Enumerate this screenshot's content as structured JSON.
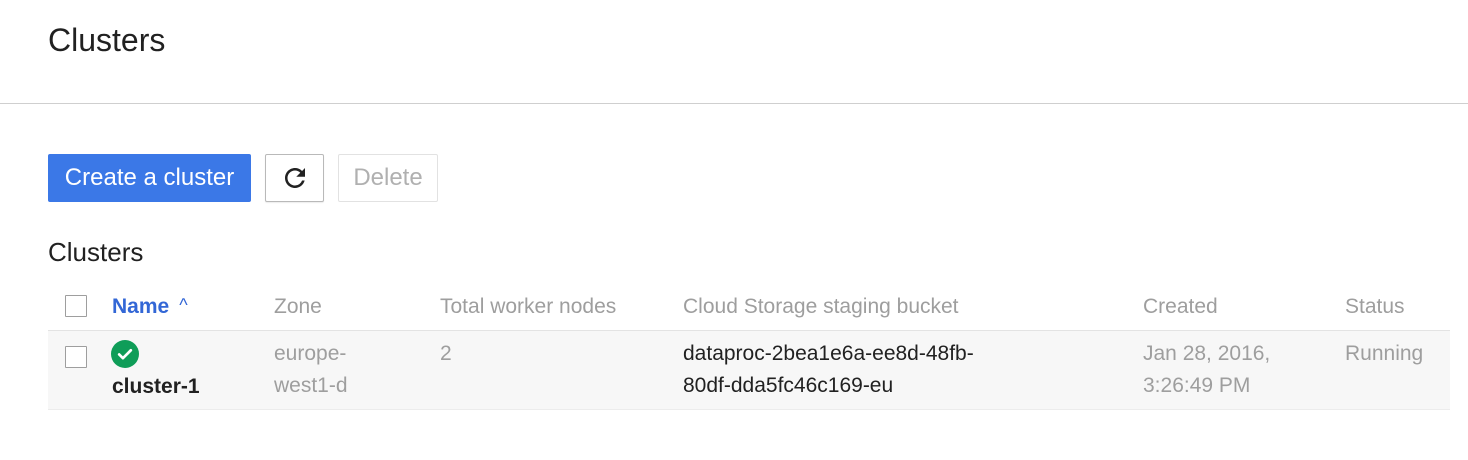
{
  "header": {
    "title": "Clusters"
  },
  "toolbar": {
    "create_label": "Create a cluster",
    "refresh_icon": "refresh-icon",
    "delete_label": "Delete"
  },
  "section": {
    "title": "Clusters"
  },
  "table": {
    "columns": {
      "name": "Name",
      "zone": "Zone",
      "nodes": "Total worker nodes",
      "bucket": "Cloud Storage staging bucket",
      "created": "Created",
      "status": "Status"
    },
    "sort_icon": "^",
    "rows": [
      {
        "status_icon": "check-circle-icon",
        "name": "cluster-1",
        "zone_line1": "europe-",
        "zone_line2": "west1-d",
        "nodes": "2",
        "bucket_line1": "dataproc-2bea1e6a-ee8d-48fb-",
        "bucket_line2": "80df-dda5fc46c169-eu",
        "created_line1": "Jan 28, 2016,",
        "created_line2": "3:26:49 PM",
        "status": "Running"
      }
    ]
  },
  "colors": {
    "primary": "#3b78e7",
    "link": "#3367d6",
    "success": "#0f9d58"
  }
}
